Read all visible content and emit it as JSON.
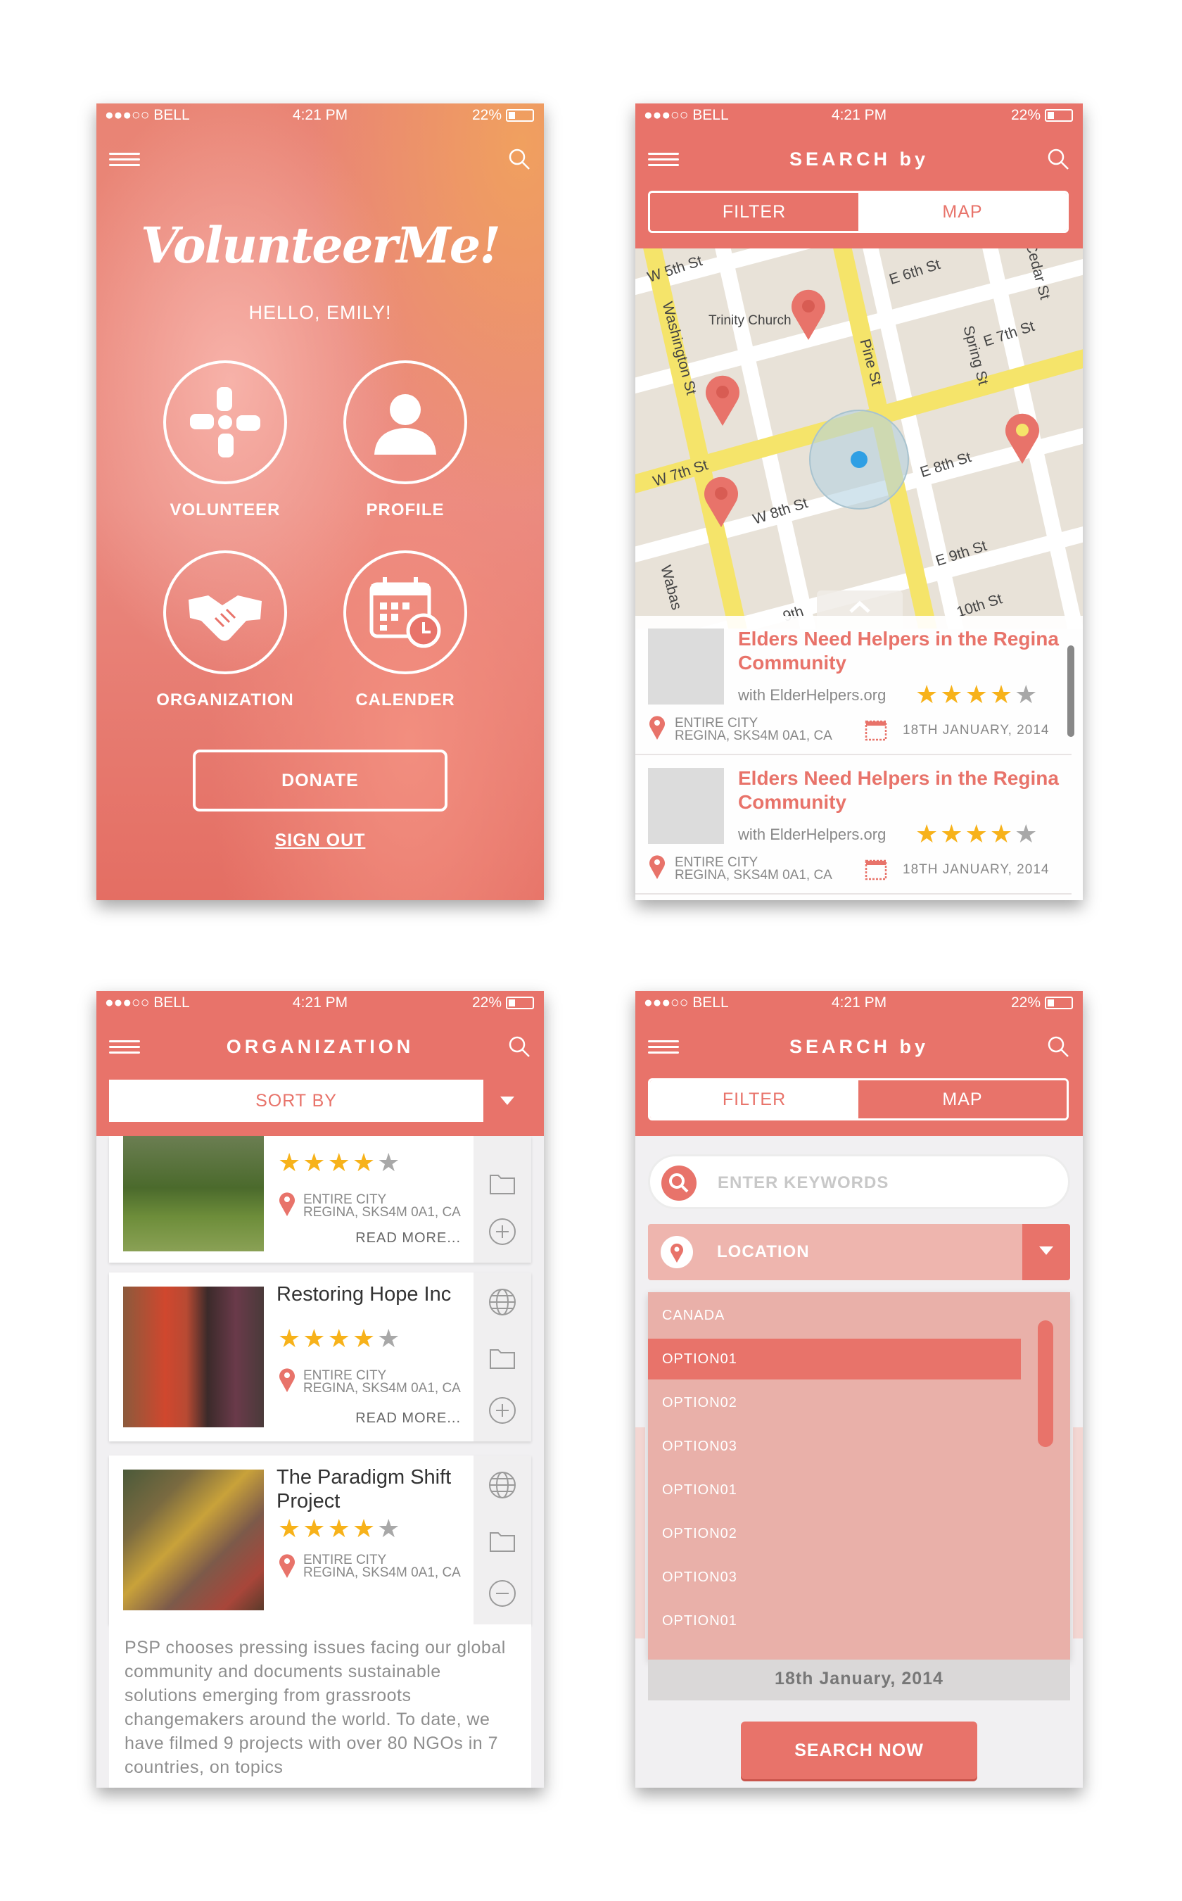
{
  "status": {
    "carrier": "●●●○○ BELL",
    "time": "4:21 PM",
    "battery": "22%"
  },
  "home": {
    "logo": "VolunteerMe!",
    "greeting": "HELLO, EMILY!",
    "buttons": [
      "VOLUNTEER",
      "PROFILE",
      "ORGANIZATION",
      "CALENDER"
    ],
    "donate": "DONATE",
    "signout": "SIGN OUT"
  },
  "search_map": {
    "title": "SEARCH by",
    "tabs": [
      "FILTER",
      "MAP"
    ],
    "streets": [
      "W 5th St",
      "E 6th St",
      "Cedar St",
      "Trinity Church",
      "Washington St",
      "Pine St",
      "Spring St",
      "E 7th St",
      "W 7th St",
      "E 8th St",
      "W 8th St",
      "E 9th St",
      "Wabas",
      "9th",
      "10th St"
    ],
    "results": [
      {
        "title": "Elders Need Helpers in the Regina Community",
        "with": "with ElderHelpers.org",
        "rating": 4,
        "loc1": "ENTIRE CITY",
        "loc2": "REGINA, SKS4M 0A1, CA",
        "date": "18TH JANUARY, 2014"
      },
      {
        "title": "Elders Need Helpers in the Regina Community",
        "with": "with ElderHelpers.org",
        "rating": 4,
        "loc1": "ENTIRE CITY",
        "loc2": "REGINA, SKS4M 0A1, CA",
        "date": "18TH JANUARY, 2014"
      }
    ]
  },
  "organization": {
    "title": "ORGANIZATION",
    "sort_label": "SORT BY",
    "items": [
      {
        "name": "",
        "rating": 4,
        "loc1": "ENTIRE CITY",
        "loc2": "REGINA, SKS4M 0A1, CA",
        "readmore": "READ MORE..."
      },
      {
        "name": "Restoring Hope Inc",
        "rating": 4,
        "loc1": "ENTIRE CITY",
        "loc2": "REGINA, SKS4M 0A1, CA",
        "readmore": "READ MORE..."
      },
      {
        "name": "The Paradigm Shift Project",
        "rating": 4,
        "loc1": "ENTIRE CITY",
        "loc2": "REGINA, SKS4M 0A1, CA"
      }
    ],
    "description": "PSP chooses pressing issues facing our global community and documents sustainable solutions emerging from grassroots changemakers around the world. To date, we have filmed 9 projects with over 80 NGOs in 7 countries, on topics"
  },
  "search_filter": {
    "title": "SEARCH by",
    "tabs": [
      "FILTER",
      "MAP"
    ],
    "keywords_placeholder": "ENTER KEYWORDS",
    "location_label": "LOCATION",
    "options": [
      "CANADA",
      "OPTION01",
      "OPTION02",
      "OPTION03",
      "OPTION01",
      "OPTION02",
      "OPTION03",
      "OPTION01"
    ],
    "selected_index": 1,
    "date": "18th January, 2014",
    "search_button": "SEARCH NOW"
  },
  "colors": {
    "accent": "#e8736a",
    "star": "#f7b21a",
    "road": "#f5e46a",
    "map_bg": "#e8e2d8"
  }
}
